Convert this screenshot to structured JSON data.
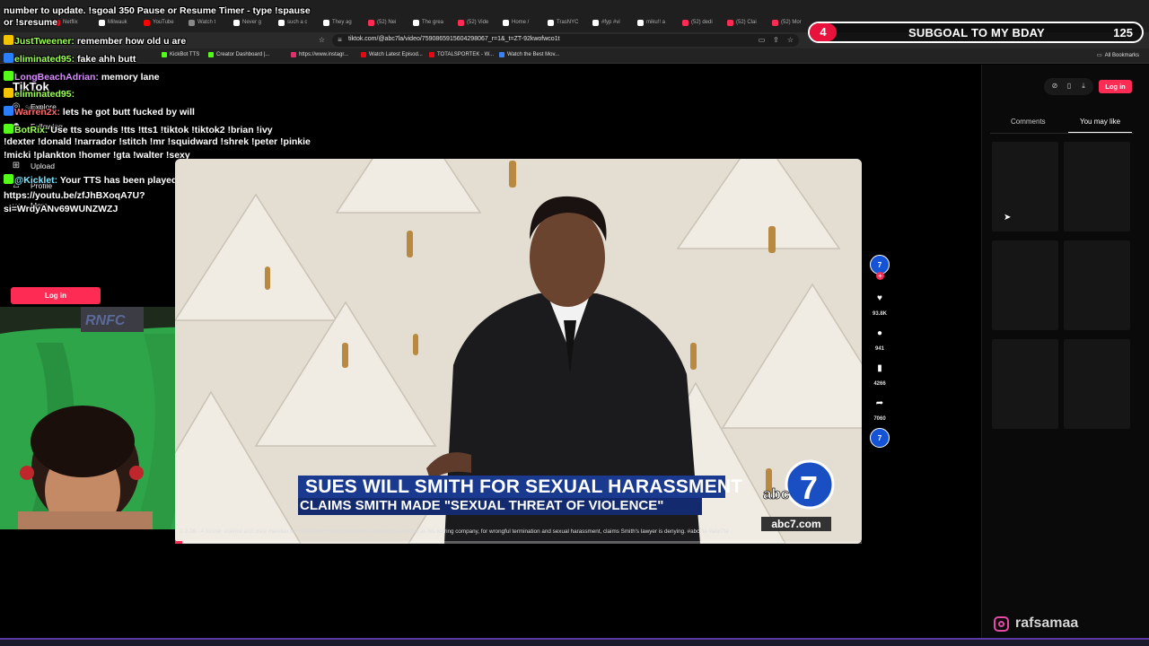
{
  "browser": {
    "tabs": [
      {
        "label": "Netflix",
        "color": "#e50914"
      },
      {
        "label": "Milwauk",
        "color": "#ffffff"
      },
      {
        "label": "YouTube",
        "color": "#ff0000"
      },
      {
        "label": "Watch t",
        "color": "#888888"
      },
      {
        "label": "Never g",
        "color": "#ffffff"
      },
      {
        "label": "such a c",
        "color": "#ffffff"
      },
      {
        "label": "They ag",
        "color": "#ffffff"
      },
      {
        "label": "(52) Nei",
        "color": "#fe2c55"
      },
      {
        "label": "The grea",
        "color": "#ffffff"
      },
      {
        "label": "(52) Vide",
        "color": "#fe2c55"
      },
      {
        "label": "Home /",
        "color": "#ffffff"
      },
      {
        "label": "TrasNYC",
        "color": "#ffffff"
      },
      {
        "label": "#fyp #vi",
        "color": "#ffffff"
      },
      {
        "label": "miku!! a",
        "color": "#ffffff"
      },
      {
        "label": "(52) dedi",
        "color": "#fe2c55"
      },
      {
        "label": "(52) Clai",
        "color": "#fe2c55"
      },
      {
        "label": "(52) Mor",
        "color": "#fe2c55"
      }
    ],
    "url": "tiktok.com/@abc7la/video/7590865915604298067_r=1&_t=ZT-92kwofwco1t",
    "bookmarks": [
      {
        "label": "KickBot TTS",
        "color": "#53fc18"
      },
      {
        "label": "Creator Dashboard |...",
        "color": "#53fc18"
      },
      {
        "label": "https://www.instagr...",
        "color": "#e1306c"
      },
      {
        "label": "Watch Latest Episod...",
        "color": "#e50914"
      },
      {
        "label": "TOTALSPORTEK - W...",
        "color": "#e50914"
      },
      {
        "label": "Watch the Best Mov...",
        "color": "#3b82f6"
      }
    ],
    "all_bookmarks": "All Bookmarks"
  },
  "subgoal": {
    "number": "4",
    "text": "SUBGOAL TO MY BDAY",
    "count": "125"
  },
  "chat": {
    "lines": [
      {
        "user": "",
        "text": "number to update. !sgoal 350 Pause or Resume Timer - type !spause",
        "cls": ""
      },
      {
        "user": "",
        "text": "or !sresume",
        "cls": ""
      },
      {
        "user": "JustTweener:",
        "text": "remember how old u are",
        "cls": ""
      },
      {
        "user": "eliminated95:",
        "text": "fake ahh butt",
        "cls": ""
      },
      {
        "user": "LongBeachAdrian:",
        "text": "memory lane",
        "cls": "purple"
      },
      {
        "user": "eliminated95:",
        "text": "",
        "cls": ""
      },
      {
        "user": "Warren2x:",
        "text": "lets he got butt fucked by will",
        "cls": "red"
      },
      {
        "user": "BotRix:",
        "text": "Use tts sounds !tts !tts1 !tiktok !tiktok2 !brian !ivy",
        "cls": ""
      },
      {
        "user": "",
        "text": "!dexter !donald !narrador !stitch !mr !squidward !shrek !peter !pinkie",
        "cls": ""
      },
      {
        "user": "",
        "text": "!micki !plankton !homer !gta !walter !sexy",
        "cls": ""
      },
      {
        "user": "@Kicklet:",
        "text": "Your TTS has been played successfully.",
        "cls": "teal"
      },
      {
        "user": "",
        "text": "https://youtu.be/zfJhBXoqA7U?",
        "cls": ""
      },
      {
        "user": "",
        "text": "si=WrdyANv69WUNZWZJ",
        "cls": ""
      }
    ]
  },
  "tiktok": {
    "logo": "TikTok",
    "search": "Search",
    "sidebar": [
      {
        "label": "Explore",
        "icon": "compass-icon",
        "glyph": "◎"
      },
      {
        "label": "Following",
        "icon": "following-icon",
        "glyph": "☻"
      },
      {
        "label": "Upload",
        "icon": "upload-icon",
        "glyph": "⊞"
      },
      {
        "label": "Profile",
        "icon": "profile-icon",
        "glyph": "♙"
      },
      {
        "label": "More",
        "icon": "more-icon",
        "glyph": "⋯"
      }
    ],
    "login_label": "Log in"
  },
  "video": {
    "headline": "SUES WILL SMITH FOR SEXUAL HARASSMENT",
    "subheadline": "CLAIMS SMITH MADE \"SEXUAL THREAT OF VIOLENCE\"",
    "logo_text": "abc",
    "logo_num": "7",
    "url": "abc7.com",
    "description": "1-2-26 - A former violinist and crew member for #WillSmith is suing the actor and rapper, as well as his touring company, for wrongful termination and sexual harassment, claims Smith's lawyer is denying. #abc7la #abc7la",
    "progress": 0.01
  },
  "actions": {
    "likes": "93.8K",
    "comments": "941",
    "saves": "4266",
    "shares": "7060"
  },
  "right_panel": {
    "login_label": "Log in",
    "tabs": [
      {
        "label": "Comments",
        "active": false
      },
      {
        "label": "You may like",
        "active": true
      }
    ]
  },
  "stream": {
    "handle": "rafsamaa"
  }
}
